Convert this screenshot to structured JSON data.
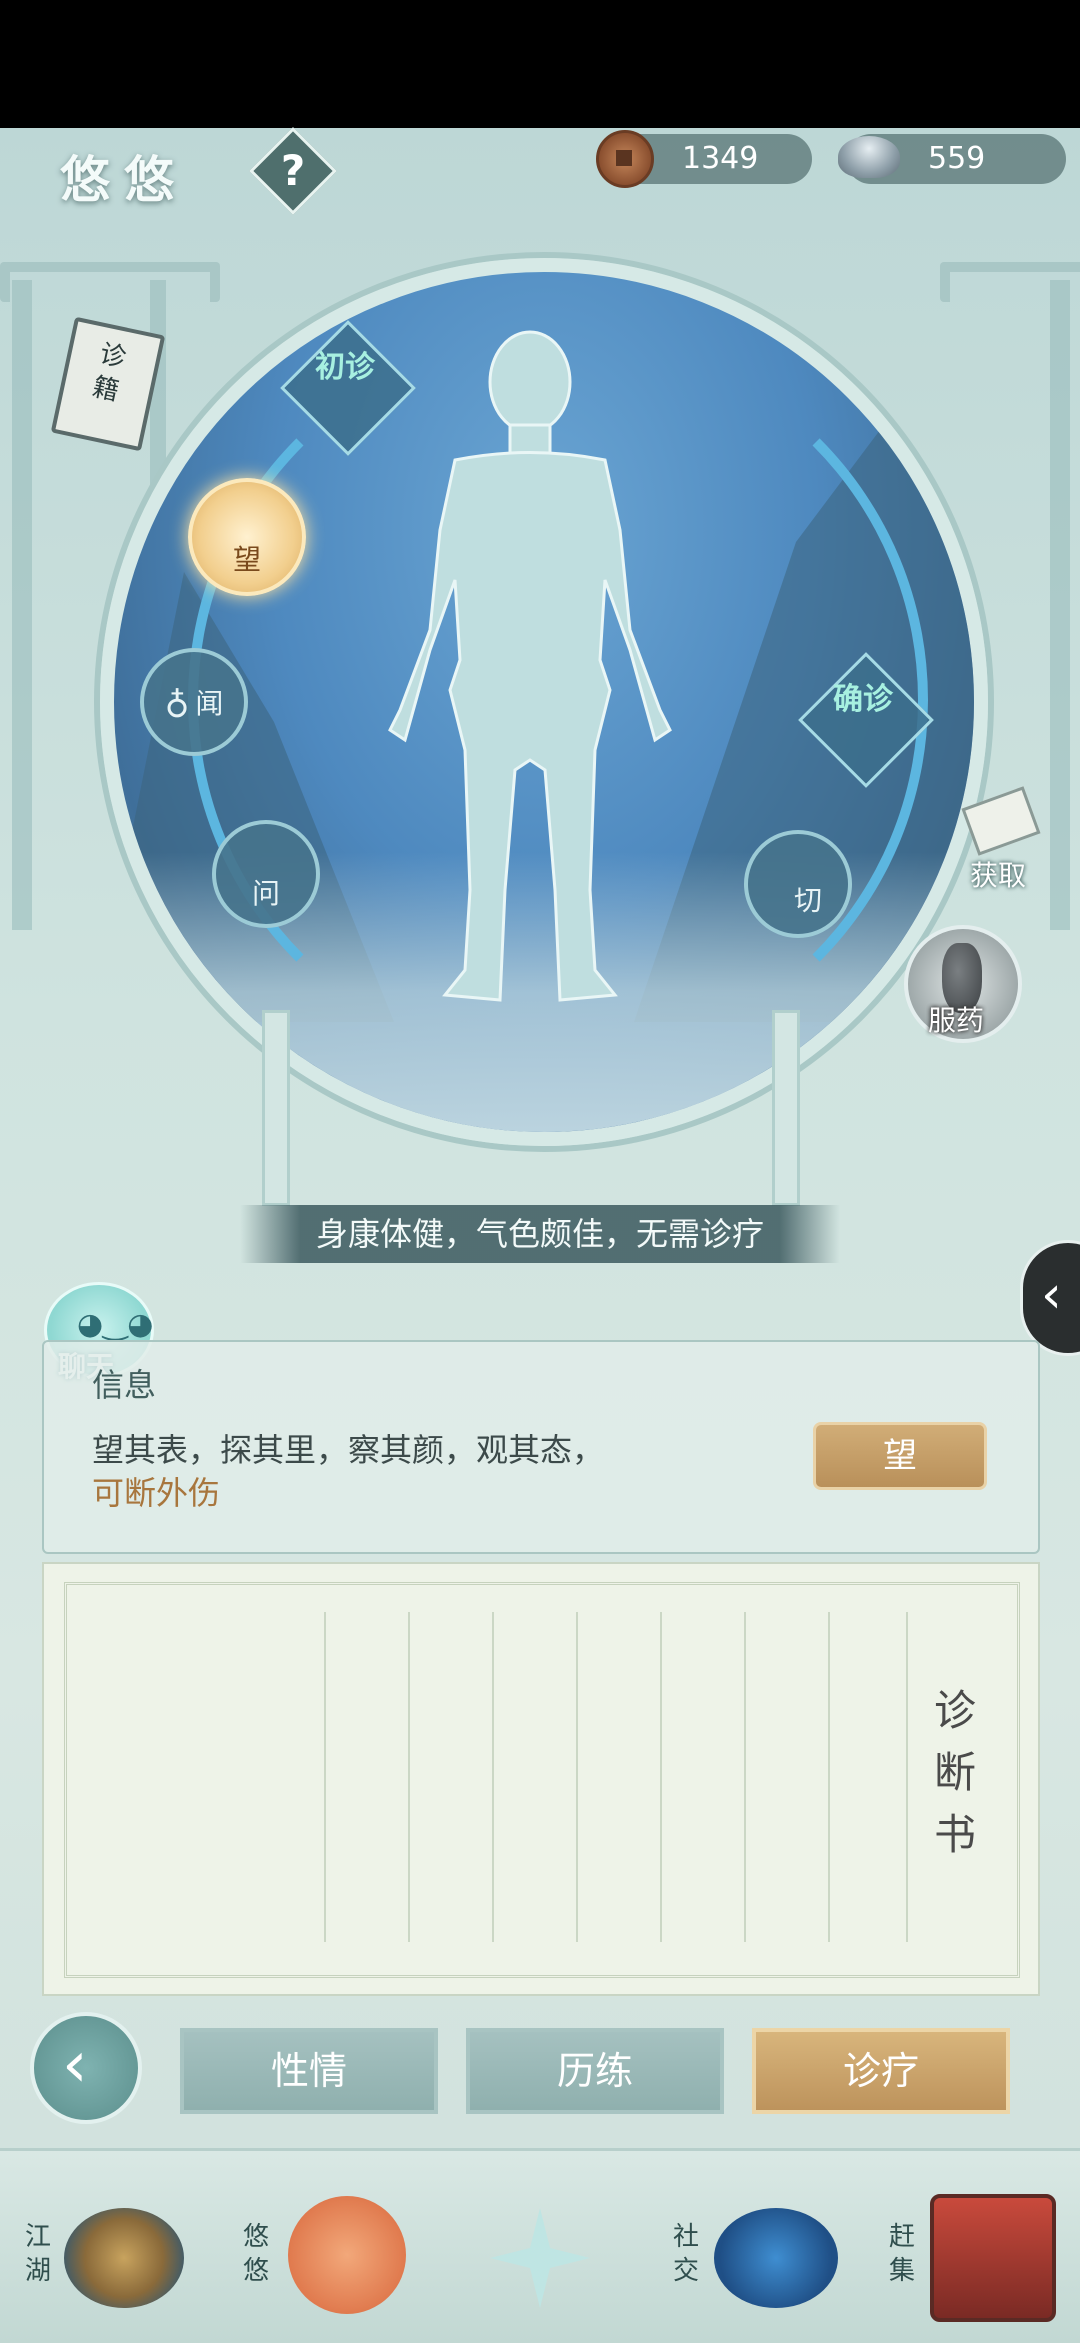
{
  "status_bar": {},
  "header": {
    "title": "悠悠",
    "help_label": "?",
    "copper_coins": "1349",
    "silver_ingots": "559"
  },
  "book": {
    "label": "诊籍"
  },
  "diagnosis": {
    "initial_label": "初诊",
    "confirm_label": "确诊",
    "methods": [
      {
        "label": "望",
        "active": true
      },
      {
        "label": "闻",
        "active": false
      },
      {
        "label": "问",
        "active": false
      },
      {
        "label": "切",
        "active": false
      }
    ],
    "result_text": "身康体健，气色颇佳，无需诊疗"
  },
  "side": {
    "obtain_label": "获取",
    "medicine_label": "服药"
  },
  "chat": {
    "label": "聊天"
  },
  "info": {
    "title": "信息",
    "line1": "望其表，探其里，察其颜，观其态，",
    "line2": "可断外伤",
    "button_label": "望"
  },
  "diagnosis_book": {
    "title_chars": [
      "诊",
      "断",
      "书"
    ]
  },
  "tabs": [
    {
      "label": "性情",
      "selected": false
    },
    {
      "label": "历练",
      "selected": false
    },
    {
      "label": "诊疗",
      "selected": true
    }
  ],
  "bottom_nav": [
    {
      "label": "江湖"
    },
    {
      "label": "悠悠"
    },
    {
      "label": ""
    },
    {
      "label": "社交"
    },
    {
      "label": "赶集"
    }
  ],
  "colors": {
    "accent_gold": "#c9a36b",
    "teal_gray": "#9dbdbb",
    "circle_blue": "#4e89bf"
  }
}
